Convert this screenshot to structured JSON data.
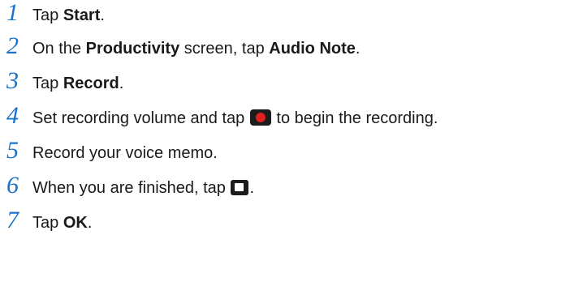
{
  "steps": [
    {
      "number": "1",
      "pre": "Tap ",
      "bold": "Start",
      "post": "."
    },
    {
      "number": "2",
      "pre": "On the ",
      "bold1": "Productivity",
      "mid": " screen, tap ",
      "bold2": "Audio Note",
      "post": "."
    },
    {
      "number": "3",
      "pre": "Tap ",
      "bold": "Record",
      "post": "."
    },
    {
      "number": "4",
      "pre": "Set recording volume and tap ",
      "icon": "record-button-icon",
      "post": " to begin the recording."
    },
    {
      "number": "5",
      "text": "Record your voice memo."
    },
    {
      "number": "6",
      "pre": "When you are finished, tap ",
      "icon": "stop-button-icon",
      "post": "."
    },
    {
      "number": "7",
      "pre": "Tap ",
      "bold": "OK",
      "post": "."
    }
  ],
  "colors": {
    "step_number": "#1a73c8",
    "text": "#1a1a1a",
    "record_dot": "#e0201c",
    "icon_background": "#1c1c1c"
  }
}
